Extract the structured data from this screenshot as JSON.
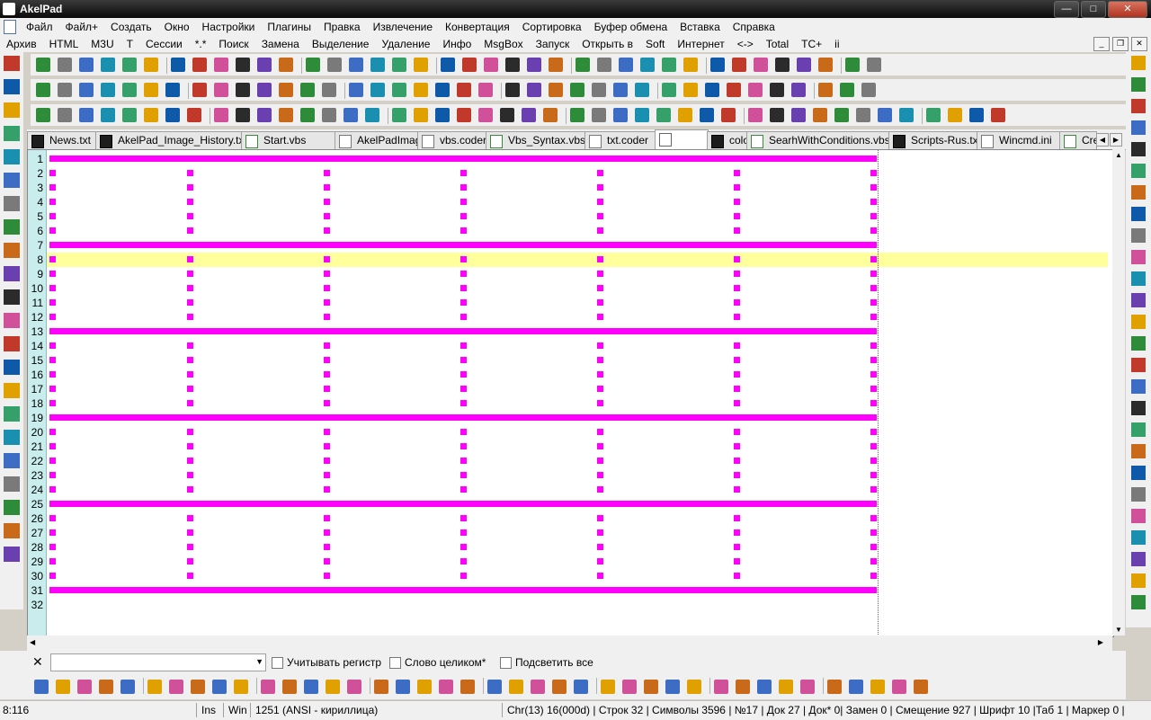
{
  "window": {
    "title": "AkelPad"
  },
  "menu_main": [
    "Файл",
    "Файл+",
    "Создать",
    "Окно",
    "Настройки",
    "Плагины",
    "Правка",
    "Извлечение",
    "Конвертация",
    "Сортировка",
    "Буфер обмена",
    "Вставка",
    "Справка"
  ],
  "menu_user": [
    "Архив",
    "HTML",
    "M3U",
    "T",
    "Сессии",
    "*.*",
    "Поиск",
    "Замена",
    "Выделение",
    "Удаление",
    "Инфо",
    "MsgBox",
    "Запуск",
    "Открыть в",
    "Soft",
    "Интернет",
    "<->",
    "Total",
    "TC+",
    "ii"
  ],
  "tabs": [
    {
      "label": "News.txt",
      "icon": "txt-file-icon"
    },
    {
      "label": "AkelPad_Image_History.txt",
      "icon": "txt-file-icon"
    },
    {
      "label": "Start.vbs",
      "icon": "vbs-file-icon"
    },
    {
      "label": "AkelPadImage.ini",
      "icon": "ini-file-icon"
    },
    {
      "label": "vbs.coder",
      "icon": "coder-file-icon"
    },
    {
      "label": "Vbs_Syntax.vbs",
      "icon": "vbs-file-icon"
    },
    {
      "label": "txt.coder",
      "icon": "coder-file-icon"
    },
    {
      "label": "",
      "icon": "blank-file-icon"
    },
    {
      "label": "color.js",
      "icon": "txt-file-icon"
    },
    {
      "label": "SearhWithConditions.vbs",
      "icon": "vbs-file-icon"
    },
    {
      "label": "Scripts-Rus.txt",
      "icon": "txt-file-icon"
    },
    {
      "label": "Wincmd.ini",
      "icon": "ini-file-icon"
    },
    {
      "label": "Cre",
      "icon": "vbs-file-icon"
    }
  ],
  "editor": {
    "line_numbers": [
      "1",
      "2",
      "3",
      "4",
      "5",
      "6",
      "7",
      "8",
      "9",
      "10",
      "11",
      "12",
      "13",
      "14",
      "15",
      "16",
      "17",
      "18",
      "19",
      "20",
      "21",
      "22",
      "23",
      "24",
      "25",
      "26",
      "27",
      "28",
      "29",
      "30",
      "31",
      "32"
    ],
    "current_line": 8,
    "colors": {
      "pattern": "#ff00ff",
      "current_line": "#ffff9c",
      "gutter": "#c9ecec"
    }
  },
  "find": {
    "value": "",
    "match_case": "Учитывать регистр",
    "whole_word": "Слово целиком*",
    "highlight_all": "Подсветить все"
  },
  "status": {
    "position": "8:116",
    "mode": "Ins",
    "newline": "Win",
    "codepage": "1251  (ANSI - кириллица)",
    "info": "Chr(13) 16(000d) | Строк 32 | Символы 3596 | №17 | Док 27 | Док* 0| Замен 0 | Смещение 927 | Шрифт 10 |Таб 1 | Маркер 0 |"
  }
}
